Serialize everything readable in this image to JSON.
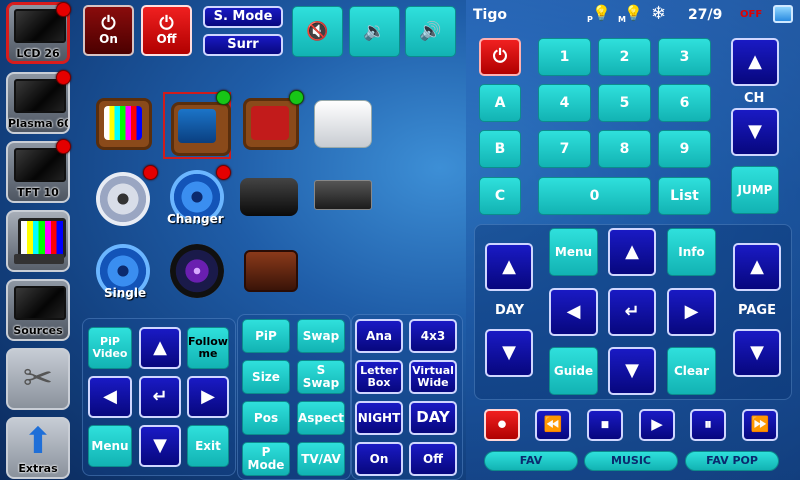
{
  "sidebar": {
    "devices": [
      {
        "label": "LCD 26",
        "selected": true,
        "status": "red"
      },
      {
        "label": "Plasma 60",
        "selected": false,
        "status": "red"
      },
      {
        "label": "TFT 10",
        "selected": false,
        "status": "red"
      },
      {
        "label": "",
        "selected": false
      },
      {
        "label": "Sources",
        "selected": false
      },
      {
        "label": "",
        "selected": false
      },
      {
        "label": "Extras",
        "selected": false
      }
    ]
  },
  "top": {
    "on_label": "On",
    "off_label": "Off",
    "smode_label": "S. Mode",
    "surr_label": "Surr",
    "power_icon": "⏻",
    "mute_icon": "🔇",
    "vol_down_icon": "🔉",
    "vol_up_icon": "🔊"
  },
  "sources": [
    {
      "name": "tv-color-bars-icon",
      "label": ""
    },
    {
      "name": "digital-tv-icon",
      "label": "",
      "status": "green",
      "selected": true
    },
    {
      "name": "dish-network-tv-icon",
      "label": "",
      "status": "green"
    },
    {
      "name": "mac-mini-icon",
      "label": ""
    },
    {
      "name": "dvd-disc-icon",
      "label": "",
      "status": "red"
    },
    {
      "name": "bluray-changer-icon",
      "label": "Changer",
      "status": "red"
    },
    {
      "name": "apple-tv-icon",
      "label": ""
    },
    {
      "name": "dvr-icon",
      "label": ""
    },
    {
      "name": "bluray-single-icon",
      "label": "Single"
    },
    {
      "name": "camera-lens-icon",
      "label": ""
    },
    {
      "name": "radio-icon",
      "label": ""
    }
  ],
  "nav_left": {
    "pip_video": "PiP Video",
    "follow_me": "Follow me",
    "menu": "Menu",
    "exit": "Exit",
    "up": "▲",
    "down": "▼",
    "left": "◀",
    "right": "▶",
    "enter": "↵"
  },
  "pip_panel": {
    "pip": "PiP",
    "swap": "Swap",
    "size": "Size",
    "s_swap": "S Swap",
    "pos": "Pos",
    "aspect": "Aspect",
    "p_mode": "P Mode",
    "tv_av": "TV/AV"
  },
  "aspect_panel": {
    "ana": "Ana",
    "r4x3": "4x3",
    "letterbox": "Letter Box",
    "virtual_wide": "Virtual Wide",
    "night": "NIGHT",
    "day": "DAY",
    "on": "On",
    "off": "Off"
  },
  "status_bar": {
    "provider": "Tigo",
    "date": "27/9",
    "state": "OFF",
    "p_label": "P",
    "m_label": "M",
    "state_color": "#e00000"
  },
  "keypad": {
    "power": "⏻",
    "digits": [
      "1",
      "2",
      "3",
      "4",
      "5",
      "6",
      "7",
      "8",
      "9",
      "0"
    ],
    "a": "A",
    "b": "B",
    "c": "C",
    "list": "List",
    "ch_label": "CH",
    "jump": "JUMP",
    "up": "▲",
    "down": "▼"
  },
  "nav_right": {
    "menu": "Menu",
    "info": "Info",
    "guide": "Guide",
    "clear": "Clear",
    "day_label": "DAY",
    "page_label": "PAGE",
    "up": "▲",
    "down": "▼",
    "left": "◀",
    "right": "▶",
    "enter": "↵"
  },
  "transport": {
    "record": "⏺",
    "rewind": "⏪",
    "stop": "⏹",
    "play": "▶",
    "pause": "⏸",
    "ffwd": "⏩",
    "fav": "FAV",
    "music": "MUSIC",
    "fav_pop": "FAV POP"
  },
  "colors": {
    "navy": "#0b0b9e",
    "teal": "#1fcfcc",
    "red": "#d90000",
    "accent": "#1f5da8"
  }
}
